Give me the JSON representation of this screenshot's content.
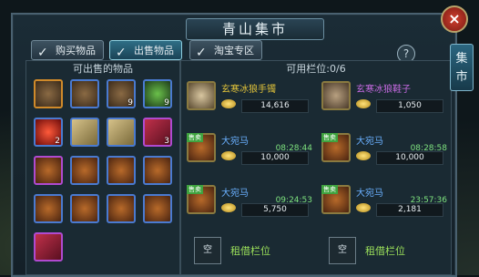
{
  "window": {
    "title": "青山集市",
    "side_tab": "集市"
  },
  "tabs": [
    {
      "label": "购买物品",
      "active": false
    },
    {
      "label": "出售物品",
      "active": true
    },
    {
      "label": "淘宝专区",
      "active": false
    }
  ],
  "help_label": "?",
  "close_label": "×",
  "left_panel": {
    "title": "可出售的物品",
    "items": [
      {
        "icon": "scarecrow-icon",
        "qty": "",
        "border": "#d08a2a"
      },
      {
        "icon": "scarecrow-icon",
        "qty": "",
        "border": "#4a7ad0"
      },
      {
        "icon": "scarecrow-icon",
        "qty": "9",
        "border": "#4a7ad0"
      },
      {
        "icon": "herb-icon",
        "qty": "9",
        "border": "#4a7ad0"
      },
      {
        "icon": "red-orb-icon",
        "qty": "2",
        "border": "#4a7ad0"
      },
      {
        "icon": "scroll-icon",
        "qty": "",
        "border": "#4a7ad0"
      },
      {
        "icon": "scroll-icon",
        "qty": "",
        "border": "#4a7ad0"
      },
      {
        "icon": "red-book-icon",
        "qty": "3",
        "border": "#b04ad0"
      },
      {
        "icon": "horse-icon",
        "qty": "",
        "border": "#b04ad0"
      },
      {
        "icon": "horse-icon",
        "qty": "",
        "border": "#4a7ad0"
      },
      {
        "icon": "horse-icon",
        "qty": "",
        "border": "#4a7ad0"
      },
      {
        "icon": "horse-icon",
        "qty": "",
        "border": "#4a7ad0"
      },
      {
        "icon": "horse-icon",
        "qty": "",
        "border": "#4a7ad0"
      },
      {
        "icon": "horse-icon",
        "qty": "",
        "border": "#4a7ad0"
      },
      {
        "icon": "horse-icon",
        "qty": "",
        "border": "#4a7ad0"
      },
      {
        "icon": "horse-icon",
        "qty": "",
        "border": "#4a7ad0"
      },
      {
        "icon": "red-book-icon",
        "qty": "",
        "border": "#b04ad0"
      }
    ]
  },
  "right_panel": {
    "title": "可用栏位:0/6",
    "listings": [
      {
        "name": "玄寒冰狼手镯",
        "name_color": "#e0c23a",
        "time": "",
        "price": "14,616",
        "icon": "bracelet-icon",
        "tag": ""
      },
      {
        "name": "玄寒冰狼鞋子",
        "name_color": "#c56ae0",
        "time": "",
        "price": "1,050",
        "icon": "boots-icon",
        "tag": ""
      },
      {
        "name": "大宛马",
        "name_color": "#6ab0ff",
        "time": "08:28:44",
        "price": "10,000",
        "icon": "horse-icon",
        "tag": "售卖"
      },
      {
        "name": "大宛马",
        "name_color": "#6ab0ff",
        "time": "08:28:58",
        "price": "10,000",
        "icon": "horse-icon",
        "tag": "售卖"
      },
      {
        "name": "大宛马",
        "name_color": "#6ab0ff",
        "time": "09:24:53",
        "price": "5,750",
        "icon": "horse-icon",
        "tag": "售卖"
      },
      {
        "name": "大宛马",
        "name_color": "#6ab0ff",
        "time": "23:57:36",
        "price": "2,181",
        "icon": "horse-icon",
        "tag": "售卖"
      }
    ],
    "rent_slots": [
      {
        "empty_label": "空",
        "rent_label": "租借栏位"
      },
      {
        "empty_label": "空",
        "rent_label": "租借栏位"
      }
    ]
  }
}
